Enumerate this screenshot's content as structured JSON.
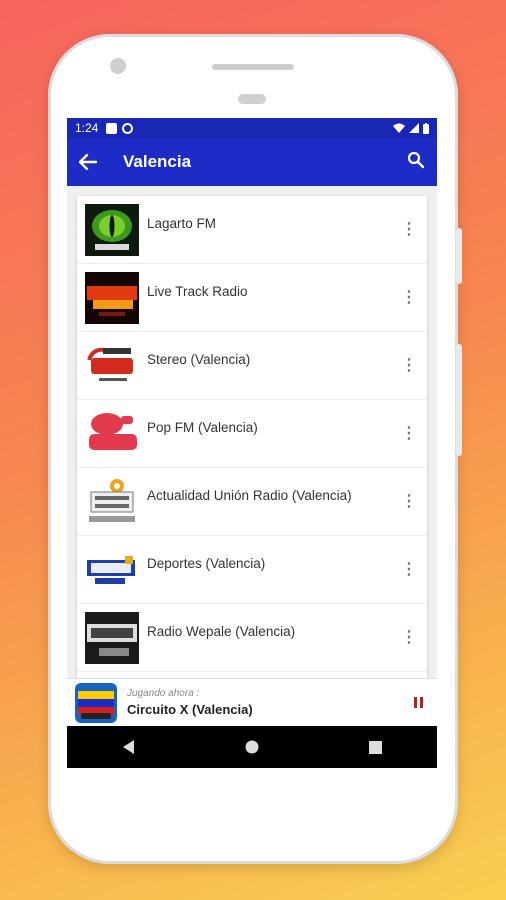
{
  "status_bar": {
    "time": "1:24"
  },
  "app_bar": {
    "title": "Valencia",
    "back_icon": "arrow-back-icon",
    "search_icon": "search-icon"
  },
  "stations": [
    {
      "name": "Lagarto FM",
      "logo": "lagarto-logo"
    },
    {
      "name": "Live Track Radio",
      "logo": "live-track-logo"
    },
    {
      "name": "Stereo (Valencia)",
      "logo": "stereo-979-logo"
    },
    {
      "name": "Pop FM (Valencia)",
      "logo": "pop-1059-logo"
    },
    {
      "name": "Actualidad Unión Radio (Valencia)",
      "logo": "union-radio-logo"
    },
    {
      "name": "Deportes (Valencia)",
      "logo": "deportes-logo"
    },
    {
      "name": "Radio Wepale (Valencia)",
      "logo": "wepale-logo"
    }
  ],
  "player": {
    "label": "Jugando ahora :",
    "station": "Circuito X (Valencia)"
  },
  "colors": {
    "app_bar": "#1d2bc7",
    "status_bar": "#1a27b4",
    "pause": "#b22222"
  }
}
